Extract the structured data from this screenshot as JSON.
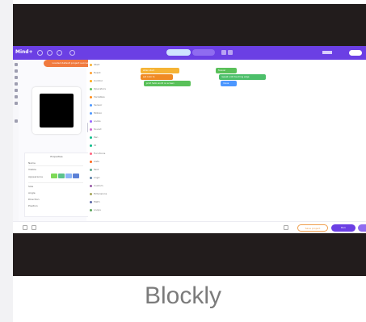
{
  "caption": "Blockly",
  "topbar": {
    "logo": "Mind+",
    "toast": "Loaded default project successfully"
  },
  "stage": {
    "props_title": "Properties",
    "props_rows": [
      "Name",
      "Visible",
      "Appearance",
      "Size",
      "Angle",
      "Direction",
      "Position"
    ]
  },
  "categories": [
    {
      "label": "Start",
      "color": "#f5b335"
    },
    {
      "label": "Event",
      "color": "#ff9f33"
    },
    {
      "label": "Control",
      "color": "#ffab19"
    },
    {
      "label": "Operators",
      "color": "#59c059"
    },
    {
      "label": "Variables",
      "color": "#ff8c1a"
    },
    {
      "label": "Sensor",
      "color": "#4c97ff"
    },
    {
      "label": "Motion",
      "color": "#4c97ff"
    },
    {
      "label": "Looks",
      "color": "#9966ff"
    },
    {
      "label": "Sound",
      "color": "#cf63cf"
    },
    {
      "label": "Pen",
      "color": "#0fbd8c"
    },
    {
      "label": "IO",
      "color": "#0fbd8c"
    },
    {
      "label": "Functions",
      "color": "#ff6680"
    },
    {
      "label": "Lists",
      "color": "#ff661a"
    },
    {
      "label": "Text",
      "color": "#5ba58c"
    },
    {
      "label": "Logic",
      "color": "#5b80a5"
    },
    {
      "label": "Custom",
      "color": "#995ba5"
    },
    {
      "label": "Extensions",
      "color": "#a5a55b"
    },
    {
      "label": "Math",
      "color": "#5b67a5"
    },
    {
      "label": "Loops",
      "color": "#5ba55b"
    }
  ],
  "blocks": {
    "b1": "when start",
    "b2": "set color to",
    "b3": "print hello world on screen",
    "b4": "forever",
    "b5": "repeat until touching edge",
    "b6": "move"
  },
  "bottom": {
    "save_label": "Save project",
    "run_label": "Run"
  }
}
